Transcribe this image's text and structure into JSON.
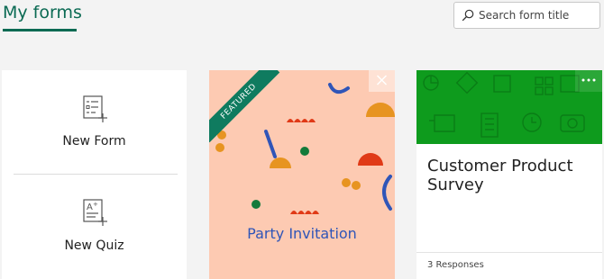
{
  "header": {
    "tab_title": "My forms",
    "search_placeholder": "Search form title"
  },
  "new_card": {
    "new_form_label": "New Form",
    "new_quiz_label": "New Quiz"
  },
  "featured_card": {
    "ribbon_label": "FEATURED",
    "title": "Party Invitation",
    "title_color": "#2f55b8",
    "background_color": "#fdcab2"
  },
  "survey_card": {
    "title": "Customer Product Survey",
    "responses": "3 Responses",
    "banner_color": "#0e9b1d"
  },
  "icons": {
    "search": "search-icon",
    "new_form": "form-add-icon",
    "new_quiz": "quiz-add-icon",
    "close": "close-icon",
    "more": "more-options-icon"
  },
  "colors": {
    "accent": "#0b6a53",
    "ribbon": "#0f7b5f"
  }
}
